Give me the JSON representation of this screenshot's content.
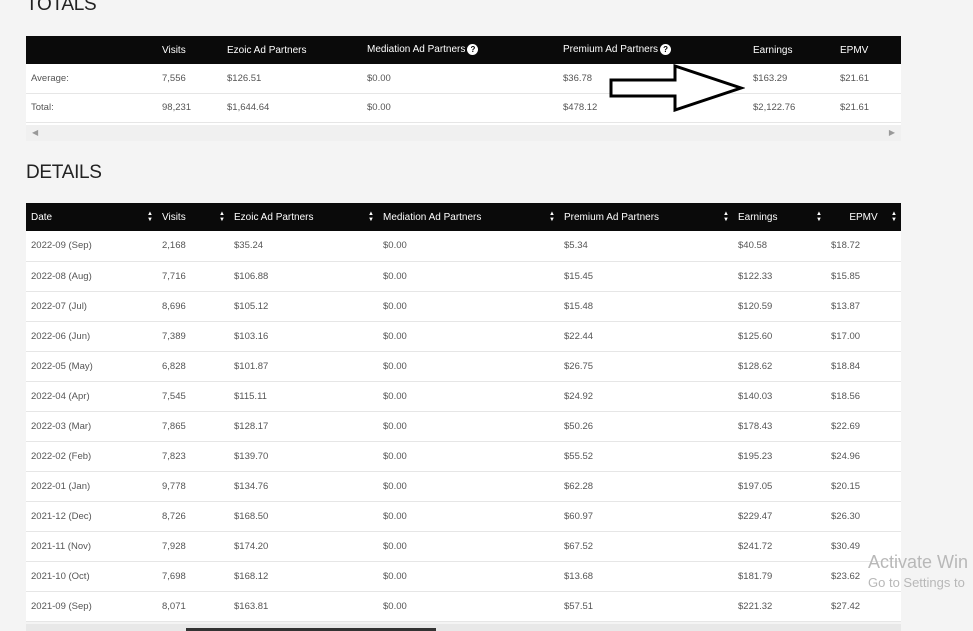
{
  "totals": {
    "title": "TOTALS",
    "columns": [
      "",
      "Visits",
      "Ezoic Ad Partners",
      "Mediation Ad Partners",
      "Premium Ad Partners",
      "Earnings",
      "EPMV"
    ],
    "rows": [
      [
        "Average:",
        "7,556",
        "$126.51",
        "$0.00",
        "$36.78",
        "$163.29",
        "$21.61"
      ],
      [
        "Total:",
        "98,231",
        "$1,644.64",
        "$0.00",
        "$478.12",
        "$2,122.76",
        "$21.61"
      ]
    ],
    "help_glyph": "?"
  },
  "details": {
    "title": "DETAILS",
    "columns": [
      "Date",
      "Visits",
      "Ezoic Ad Partners",
      "Mediation Ad Partners",
      "Premium Ad Partners",
      "Earnings",
      "EPMV"
    ],
    "rows": [
      [
        "2022-09 (Sep)",
        "2,168",
        "$35.24",
        "$0.00",
        "$5.34",
        "$40.58",
        "$18.72"
      ],
      [
        "2022-08 (Aug)",
        "7,716",
        "$106.88",
        "$0.00",
        "$15.45",
        "$122.33",
        "$15.85"
      ],
      [
        "2022-07 (Jul)",
        "8,696",
        "$105.12",
        "$0.00",
        "$15.48",
        "$120.59",
        "$13.87"
      ],
      [
        "2022-06 (Jun)",
        "7,389",
        "$103.16",
        "$0.00",
        "$22.44",
        "$125.60",
        "$17.00"
      ],
      [
        "2022-05 (May)",
        "6,828",
        "$101.87",
        "$0.00",
        "$26.75",
        "$128.62",
        "$18.84"
      ],
      [
        "2022-04 (Apr)",
        "7,545",
        "$115.11",
        "$0.00",
        "$24.92",
        "$140.03",
        "$18.56"
      ],
      [
        "2022-03 (Mar)",
        "7,865",
        "$128.17",
        "$0.00",
        "$50.26",
        "$178.43",
        "$22.69"
      ],
      [
        "2022-02 (Feb)",
        "7,823",
        "$139.70",
        "$0.00",
        "$55.52",
        "$195.23",
        "$24.96"
      ],
      [
        "2022-01 (Jan)",
        "9,778",
        "$134.76",
        "$0.00",
        "$62.28",
        "$197.05",
        "$20.15"
      ],
      [
        "2021-12 (Dec)",
        "8,726",
        "$168.50",
        "$0.00",
        "$60.97",
        "$229.47",
        "$26.30"
      ],
      [
        "2021-11 (Nov)",
        "7,928",
        "$174.20",
        "$0.00",
        "$67.52",
        "$241.72",
        "$30.49"
      ],
      [
        "2021-10 (Oct)",
        "7,698",
        "$168.12",
        "$0.00",
        "$13.68",
        "$181.79",
        "$23.62"
      ],
      [
        "2021-09 (Sep)",
        "8,071",
        "$163.81",
        "$0.00",
        "$57.51",
        "$221.32",
        "$27.42"
      ]
    ]
  },
  "watermark": {
    "line1": "Activate Win",
    "line2": "Go to Settings to"
  },
  "colors": {
    "header_bg": "#0a0a0a",
    "page_bg": "#f4f4f4"
  }
}
